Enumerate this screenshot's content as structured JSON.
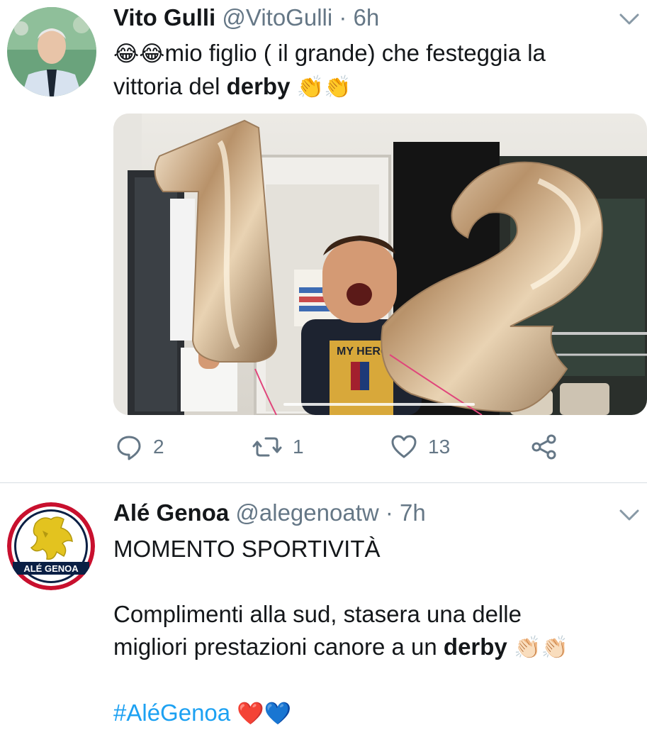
{
  "tweets": [
    {
      "name": "Vito Gulli",
      "handle": "@VitoGulli",
      "time": "· 6h",
      "text_prefix_emoji": "😂😂",
      "text_1": "mio figlio ( il grande) che festeggia la",
      "text_2": "vittoria del ",
      "text_bold": "derby",
      "text_suffix_emoji": "👏👏",
      "replies": "2",
      "retweets": "1",
      "likes": "13",
      "photo_shirt_text": "MY HERO"
    },
    {
      "name": "Alé Genoa",
      "handle": "@alegenoatw",
      "time": "· 7h",
      "avatar_label": "ALÉ GENOA",
      "line_1": "MOMENTO SPORTIVITÀ",
      "line_2": "Complimenti alla sud, stasera una delle",
      "line_3": "migliori prestazioni canore a un ",
      "line_3_bold": "derby",
      "line_3_emoji": "👏🏻👏🏻",
      "hashtag": "#AléGenoa",
      "hashtag_emoji": "❤️💙"
    }
  ],
  "colors": {
    "handle_gray": "#657786",
    "divider": "#d8dee3",
    "link_blue": "#1da1f2",
    "genoa_red": "#c8102e",
    "genoa_navy": "#0a1f44"
  }
}
